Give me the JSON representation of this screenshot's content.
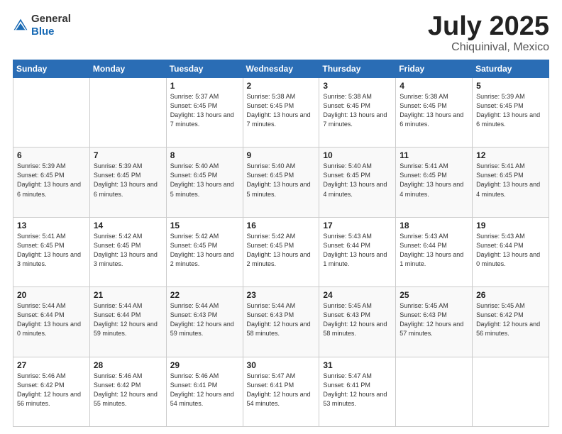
{
  "header": {
    "logo_general": "General",
    "logo_blue": "Blue",
    "month": "July 2025",
    "location": "Chiquinival, Mexico"
  },
  "weekdays": [
    "Sunday",
    "Monday",
    "Tuesday",
    "Wednesday",
    "Thursday",
    "Friday",
    "Saturday"
  ],
  "weeks": [
    [
      {
        "day": "",
        "info": ""
      },
      {
        "day": "",
        "info": ""
      },
      {
        "day": "1",
        "info": "Sunrise: 5:37 AM\nSunset: 6:45 PM\nDaylight: 13 hours and 7 minutes."
      },
      {
        "day": "2",
        "info": "Sunrise: 5:38 AM\nSunset: 6:45 PM\nDaylight: 13 hours and 7 minutes."
      },
      {
        "day": "3",
        "info": "Sunrise: 5:38 AM\nSunset: 6:45 PM\nDaylight: 13 hours and 7 minutes."
      },
      {
        "day": "4",
        "info": "Sunrise: 5:38 AM\nSunset: 6:45 PM\nDaylight: 13 hours and 6 minutes."
      },
      {
        "day": "5",
        "info": "Sunrise: 5:39 AM\nSunset: 6:45 PM\nDaylight: 13 hours and 6 minutes."
      }
    ],
    [
      {
        "day": "6",
        "info": "Sunrise: 5:39 AM\nSunset: 6:45 PM\nDaylight: 13 hours and 6 minutes."
      },
      {
        "day": "7",
        "info": "Sunrise: 5:39 AM\nSunset: 6:45 PM\nDaylight: 13 hours and 6 minutes."
      },
      {
        "day": "8",
        "info": "Sunrise: 5:40 AM\nSunset: 6:45 PM\nDaylight: 13 hours and 5 minutes."
      },
      {
        "day": "9",
        "info": "Sunrise: 5:40 AM\nSunset: 6:45 PM\nDaylight: 13 hours and 5 minutes."
      },
      {
        "day": "10",
        "info": "Sunrise: 5:40 AM\nSunset: 6:45 PM\nDaylight: 13 hours and 4 minutes."
      },
      {
        "day": "11",
        "info": "Sunrise: 5:41 AM\nSunset: 6:45 PM\nDaylight: 13 hours and 4 minutes."
      },
      {
        "day": "12",
        "info": "Sunrise: 5:41 AM\nSunset: 6:45 PM\nDaylight: 13 hours and 4 minutes."
      }
    ],
    [
      {
        "day": "13",
        "info": "Sunrise: 5:41 AM\nSunset: 6:45 PM\nDaylight: 13 hours and 3 minutes."
      },
      {
        "day": "14",
        "info": "Sunrise: 5:42 AM\nSunset: 6:45 PM\nDaylight: 13 hours and 3 minutes."
      },
      {
        "day": "15",
        "info": "Sunrise: 5:42 AM\nSunset: 6:45 PM\nDaylight: 13 hours and 2 minutes."
      },
      {
        "day": "16",
        "info": "Sunrise: 5:42 AM\nSunset: 6:45 PM\nDaylight: 13 hours and 2 minutes."
      },
      {
        "day": "17",
        "info": "Sunrise: 5:43 AM\nSunset: 6:44 PM\nDaylight: 13 hours and 1 minute."
      },
      {
        "day": "18",
        "info": "Sunrise: 5:43 AM\nSunset: 6:44 PM\nDaylight: 13 hours and 1 minute."
      },
      {
        "day": "19",
        "info": "Sunrise: 5:43 AM\nSunset: 6:44 PM\nDaylight: 13 hours and 0 minutes."
      }
    ],
    [
      {
        "day": "20",
        "info": "Sunrise: 5:44 AM\nSunset: 6:44 PM\nDaylight: 13 hours and 0 minutes."
      },
      {
        "day": "21",
        "info": "Sunrise: 5:44 AM\nSunset: 6:44 PM\nDaylight: 12 hours and 59 minutes."
      },
      {
        "day": "22",
        "info": "Sunrise: 5:44 AM\nSunset: 6:43 PM\nDaylight: 12 hours and 59 minutes."
      },
      {
        "day": "23",
        "info": "Sunrise: 5:44 AM\nSunset: 6:43 PM\nDaylight: 12 hours and 58 minutes."
      },
      {
        "day": "24",
        "info": "Sunrise: 5:45 AM\nSunset: 6:43 PM\nDaylight: 12 hours and 58 minutes."
      },
      {
        "day": "25",
        "info": "Sunrise: 5:45 AM\nSunset: 6:43 PM\nDaylight: 12 hours and 57 minutes."
      },
      {
        "day": "26",
        "info": "Sunrise: 5:45 AM\nSunset: 6:42 PM\nDaylight: 12 hours and 56 minutes."
      }
    ],
    [
      {
        "day": "27",
        "info": "Sunrise: 5:46 AM\nSunset: 6:42 PM\nDaylight: 12 hours and 56 minutes."
      },
      {
        "day": "28",
        "info": "Sunrise: 5:46 AM\nSunset: 6:42 PM\nDaylight: 12 hours and 55 minutes."
      },
      {
        "day": "29",
        "info": "Sunrise: 5:46 AM\nSunset: 6:41 PM\nDaylight: 12 hours and 54 minutes."
      },
      {
        "day": "30",
        "info": "Sunrise: 5:47 AM\nSunset: 6:41 PM\nDaylight: 12 hours and 54 minutes."
      },
      {
        "day": "31",
        "info": "Sunrise: 5:47 AM\nSunset: 6:41 PM\nDaylight: 12 hours and 53 minutes."
      },
      {
        "day": "",
        "info": ""
      },
      {
        "day": "",
        "info": ""
      }
    ]
  ]
}
